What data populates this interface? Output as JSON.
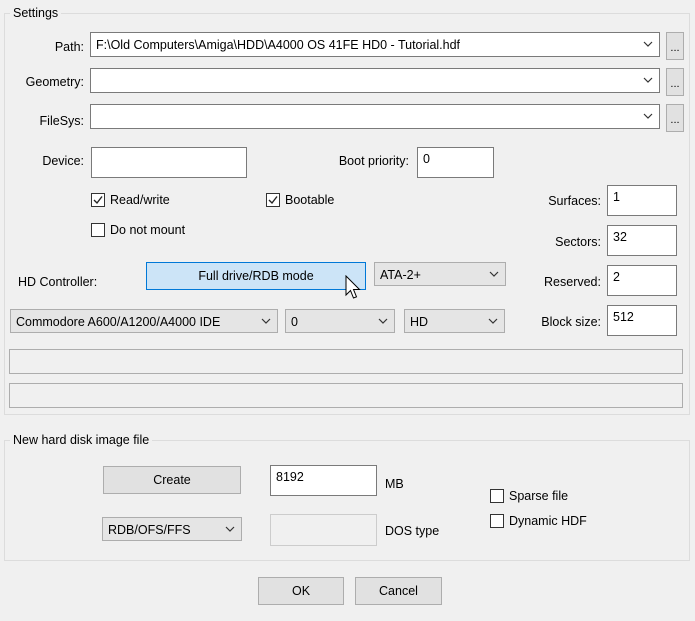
{
  "settings": {
    "title": "Settings",
    "path_label": "Path:",
    "path_value": "F:\\Old Computers\\Amiga\\HDD\\A4000 OS 41FE HD0 - Tutorial.hdf",
    "geometry_label": "Geometry:",
    "geometry_value": "",
    "filesys_label": "FileSys:",
    "filesys_value": "",
    "browse_label": "...",
    "device_label": "Device:",
    "device_value": "",
    "boot_priority_label": "Boot priority:",
    "boot_priority_value": "0",
    "read_write_label": "Read/write",
    "read_write_checked": true,
    "bootable_label": "Bootable",
    "bootable_checked": true,
    "do_not_mount_label": "Do not mount",
    "do_not_mount_checked": false,
    "surfaces_label": "Surfaces:",
    "surfaces_value": "1",
    "sectors_label": "Sectors:",
    "sectors_value": "32",
    "reserved_label": "Reserved:",
    "reserved_value": "2",
    "block_size_label": "Block size:",
    "block_size_value": "512",
    "hd_controller_label": "HD Controller:",
    "rdb_mode_button": "Full drive/RDB mode",
    "ata_mode_value": "ATA-2+",
    "controller_type_value": "Commodore A600/A1200/A4000 IDE",
    "controller_unit_value": "0",
    "controller_media_value": "HD"
  },
  "new_image": {
    "title": "New hard disk image file",
    "create_button": "Create",
    "size_value": "8192",
    "size_unit": "MB",
    "dostype_select_value": "RDB/OFS/FFS",
    "dostype_input_value": "",
    "dostype_label": "DOS type",
    "sparse_label": "Sparse file",
    "sparse_checked": false,
    "dynamic_label": "Dynamic HDF",
    "dynamic_checked": false
  },
  "footer": {
    "ok_label": "OK",
    "cancel_label": "Cancel"
  },
  "colors": {
    "active_button_bg": "#cce4f7",
    "active_button_border": "#0078d7"
  }
}
